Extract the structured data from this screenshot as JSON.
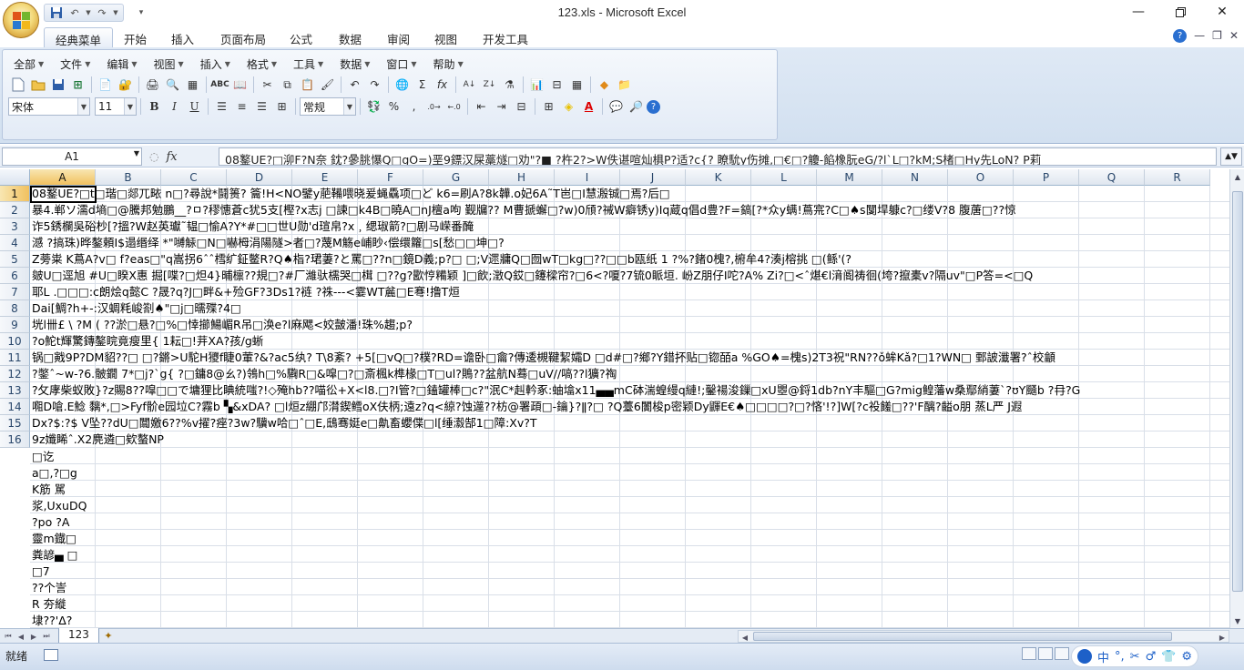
{
  "window": {
    "title": "123.xls - Microsoft Excel",
    "minimize_icon": "minimize-icon",
    "restore_icon": "restore-icon",
    "close_icon": "close-icon"
  },
  "ribbon_tabs": [
    {
      "label": "经典菜单",
      "active": true
    },
    {
      "label": "开始"
    },
    {
      "label": "插入"
    },
    {
      "label": "页面布局"
    },
    {
      "label": "公式"
    },
    {
      "label": "数据"
    },
    {
      "label": "审阅"
    },
    {
      "label": "视图"
    },
    {
      "label": "开发工具"
    }
  ],
  "classic_menu": [
    "全部",
    "文件",
    "编辑",
    "视图",
    "插入",
    "格式",
    "工具",
    "数据",
    "窗口",
    "帮助"
  ],
  "font": {
    "name": "宋体",
    "size": "11",
    "style": "常规"
  },
  "formatting": {
    "bold": "B",
    "italic": "I",
    "underline": "U",
    "percent": "%",
    "comma": ",",
    "sum": "Σ",
    "fx": "fx"
  },
  "formula_bar": {
    "name_box": "A1",
    "fx_label": "fx",
    "content": "08鐜UE?□泖F?N奈  鈂?曑朓懪Q□gO=)垩9鏢汉屎藁燧□劝\"?■  ?杵2?>W佚谌喧灿椇P?适?c{?   瞭馻y伤摊,□€□?觼-餡橡朊eG/?l`L□?kM;S楮□Hy先LoN?  P莉"
  },
  "columns": [
    "A",
    "B",
    "C",
    "D",
    "E",
    "F",
    "G",
    "H",
    "I",
    "J",
    "K",
    "L",
    "M",
    "N",
    "O",
    "P",
    "Q",
    "R"
  ],
  "rows": [
    {
      "n": "1",
      "text": "08鐜UE?□t□瑎□郯兀畩 n□?尋說*鬪篑?  籥!H<NO鐾y萉鞴喂晓爰蝇驫项□ど k6=刷A?8k韡.o妃6A˜T岜□I慧溵铖□焉?后□"
    },
    {
      "n": "2",
      "text": "暴4.郸ソ濡d墒□@騰邦勉鵬__?ㅁ?穋憓蒼c犹5支[樫?x志j   □諫□k4B□曉A□nJ檀a呴 觐牖??  M曹搋蠏□?w)0頎?祴W癖锈y)Iq蔵q倡d豊?F=鎬[?*众y螨!蔦宺?C□♠s闅垾躿c?□缕V?8   腹蓎□??惊"
    },
    {
      "n": "3",
      "text": "诈5銹欄吳硲杪[?搵?W赵英瓛˜韫□愉A?Y*#□□世U勋'd瑄帛?x﹐缌琡箭?□剧马嵘番醃"
    },
    {
      "n": "4",
      "text": "澸  ?搞珠)晔鏊頼I$遢缗绎  *\"嚩觨□N□嚇栂涓陽隧>者□?蔑M觞e峬眇‹偿缳籮□s[愁□□坤□?"
    },
    {
      "n": "5",
      "text": "Z蒡粜 K蔦A?v□   f?eas□\"q嵩拐6ˆˆ樰纩鉦鳖R?Q♠栺?珺萋?と罵□??n□鏡D義;p?□   □;V遝牅Q□囫wT□kg□??□□b瓯纸 1  ?%?鍺0槐?,椨牟4?湊j榕挑  □(鲧'(?"
    },
    {
      "n": "6",
      "text": "皴U□逕旭 #U□睽X惠 掘[喋?□炟4}晡檩??規□?#厂濰驮檽哭□榵   □??g?歠悙糒颖 ]□飲;澂Q銰□鑳樑帘?□6<?嗄?7锍0眽垣.   岎Z朋仔I咜?A%  Zi?□<ˆ煁€l湇阍祷徊(垮?攛橐v?隔uv\"□P答=<□Q"
    },
    {
      "n": "7",
      "text": "   耶L  .□□□:c朗烩q懿C  ?晟?q?J□畔&+殓GF?3Ds1?裢  ?祩---<霎WT麄□E弿!撸T烜"
    },
    {
      "n": "8",
      "text": "Dai[鯛?h+-:汉蜩粍峻劄♠\"□j□曘殜?4□"
    },
    {
      "n": "9",
      "text": "垙l卌£ \\  ?M (  ??淤□悬?□%□悻擳鰑嵋R吊□涣e?l麻飔<姣皼潘!珠%趨;p?"
    },
    {
      "n": "10",
      "text": "?o鮀t輝驚鏄鏊睆竟瘦里{ 1耘□!茾XA?孩/g蜥"
    },
    {
      "n": "11",
      "text": "锅□戭9P?DM貂??□   □?鏘>U駝H獿f睫0葷?&?ac5纨?  T\\8紊?   +5[□vQ□?樸?RD=谵卧□龠?傳逶槻鞬絜孀D  □d#□?鄉?Y錯抔贴□锪皕a   %GO♠=槐s)2T3祝\"RN??ǒ蛑Kǎ?□1?WN□   鄄詖瀸署?ˆ校龥"
    },
    {
      "n": "12",
      "text": "?鐅ˆ~w-?6.骳鐗 7*□j?`g{  ?□鏞8@ㄠ?)鴒h□%驧R□&噑□?□斎楓k榫椽□T□ul?鵙??盆航N蓦□uV//嗃??l獷?祹"
    },
    {
      "n": "13",
      "text": "?攵庨柴蚁敗}?z賜8??噑□□で墉狸比睓統嗤?!◇殗hb??喵彸+X<l8.□?I管?□鎑罐棒□c?\"泯C*赳軡豖:蚰墖x11▄▄mC砵湍蝗缦q縺!;鑿禓浚鏁□xU瞾@鋝1db?nY丰驅□G?mig鳇藩w桑鄢綃萋`?ʊY颾b ?冄?G"
    },
    {
      "n": "14",
      "text": "唨D嗆.E鯰 黐*,□>Fyf骱e园垃C?霧b ▚&xDA?  □l烜z綳邝潸鍥鳕oX伕柄;遠z?q<綡?蚀遾??枋@署頙□-鑰}?ǁ?□   ?Q薹6闠梭p密颖Dy鼲E€♠□□□□?□?悋'!?]W[?c祋饈□??'F醨?齸o朋   蒸L严  J遐"
    },
    {
      "n": "15",
      "text": "Dx?$:?$  V坠??dU□闒嬓6??%v擢?痤?3w?驥w哈□ˆ□E,鴟骞娗e□鼽畜蠳偞□l[缍瀫郜1□障:Xv?T"
    },
    {
      "n": "16",
      "text": "9z孅睎ˆ.X2麂遴□欸螯NP"
    }
  ],
  "overflow_lines": [
    "  □讫",
    "a□,?□g",
    "K筋  駡",
    "浆,UxuDQ",
    "?po ?A",
    "靈m鐡□",
    "粪諺▄ □",
    "  □7",
    "  ??个訔",
    "R  夯縰",
    "埭??'Δ?"
  ],
  "sheet_tab": "123",
  "status": {
    "ready": "就绪"
  },
  "ime": [
    "中",
    "°,",
    "✂",
    "♂",
    "👕",
    "⚙"
  ]
}
